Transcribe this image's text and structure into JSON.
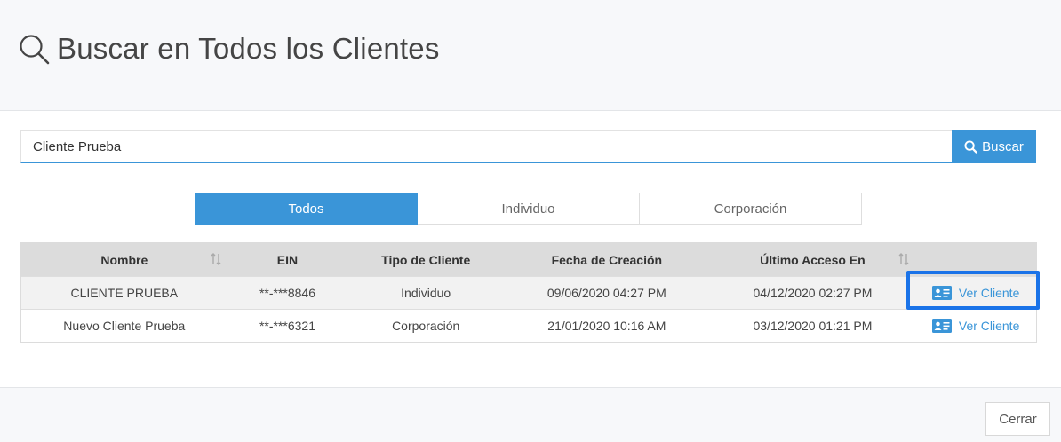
{
  "header": {
    "icon": "search-icon",
    "title": "Buscar en Todos los Clientes"
  },
  "search": {
    "value": "Cliente Prueba",
    "button_label": "Buscar",
    "button_icon": "search-icon"
  },
  "tabs": [
    {
      "label": "Todos",
      "active": true
    },
    {
      "label": "Individuo",
      "active": false
    },
    {
      "label": "Corporación",
      "active": false
    }
  ],
  "table": {
    "columns": [
      "Nombre",
      "EIN",
      "Tipo de Cliente",
      "Fecha de Creación",
      "Último Acceso En",
      ""
    ],
    "rows": [
      {
        "nombre": "CLIENTE PRUEBA",
        "ein": "**-***8846",
        "tipo": "Individuo",
        "creacion": "09/06/2020 04:27 PM",
        "acceso": "04/12/2020 02:27 PM",
        "action": "Ver Cliente"
      },
      {
        "nombre": "Nuevo Cliente Prueba",
        "ein": "**-***6321",
        "tipo": "Corporación",
        "creacion": "21/01/2020 10:16 AM",
        "acceso": "03/12/2020 01:21 PM",
        "action": "Ver Cliente"
      }
    ],
    "action_icon": "id-card-icon",
    "sort_icon": "sort-icon"
  },
  "footer": {
    "close_label": "Cerrar"
  },
  "colors": {
    "accent": "#3a95d8",
    "highlight": "#1a73e8"
  }
}
